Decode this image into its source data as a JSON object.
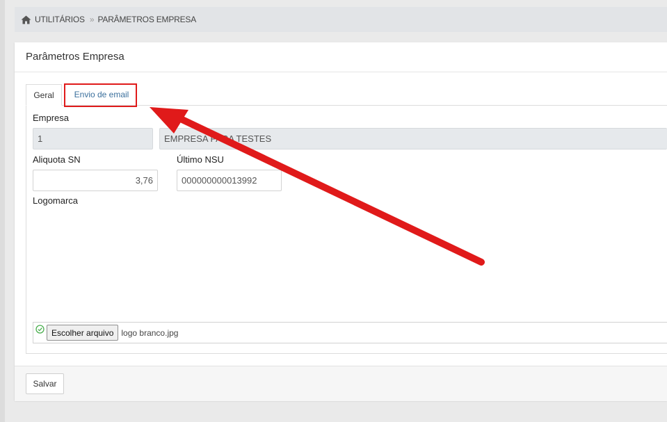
{
  "breadcrumb": {
    "home_icon": "home-icon",
    "items": [
      "UTILITÁRIOS",
      "PARÂMETROS EMPRESA"
    ],
    "separator": "»"
  },
  "card": {
    "title": "Parâmetros Empresa"
  },
  "tabs": [
    {
      "label": "Geral",
      "active": true
    },
    {
      "label": "Envio de email",
      "active": false,
      "highlighted": true
    }
  ],
  "form": {
    "empresa": {
      "label": "Empresa",
      "code": "1",
      "name": "EMPRESA PARA TESTES"
    },
    "aliquota_sn": {
      "label": "Aliquota SN",
      "value": "3,76"
    },
    "ultimo_nsu": {
      "label": "Último NSU",
      "value": "000000000013992"
    },
    "logomarca": {
      "label": "Logomarca",
      "status_icon": "check-circle-icon",
      "button_label": "Escolher arquivo",
      "file_name": "logo branco.jpg"
    }
  },
  "footer": {
    "save_label": "Salvar"
  },
  "colors": {
    "annotation": "#e01a1a",
    "tab_link": "#3a6f9c",
    "check": "#4caf50"
  }
}
